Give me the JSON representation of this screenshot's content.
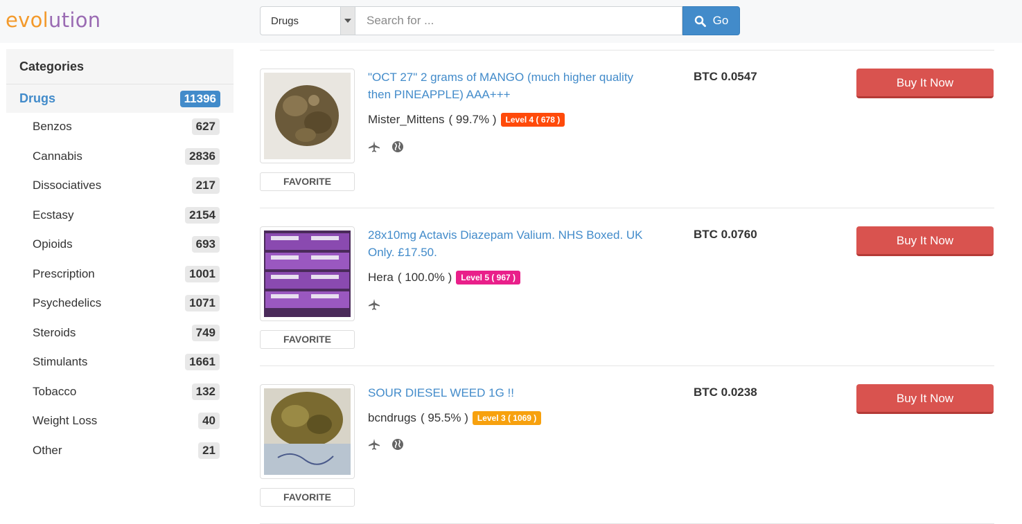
{
  "logo": {
    "part1": "evol",
    "part2": "ution"
  },
  "search": {
    "category_selected": "Drugs",
    "placeholder": "Search for ...",
    "value": "",
    "go_label": "Go"
  },
  "sidebar": {
    "heading": "Categories",
    "main": {
      "label": "Drugs",
      "count": "11396"
    },
    "items": [
      {
        "label": "Benzos",
        "count": "627"
      },
      {
        "label": "Cannabis",
        "count": "2836"
      },
      {
        "label": "Dissociatives",
        "count": "217"
      },
      {
        "label": "Ecstasy",
        "count": "2154"
      },
      {
        "label": "Opioids",
        "count": "693"
      },
      {
        "label": "Prescription",
        "count": "1001"
      },
      {
        "label": "Psychedelics",
        "count": "1071"
      },
      {
        "label": "Steroids",
        "count": "749"
      },
      {
        "label": "Stimulants",
        "count": "1661"
      },
      {
        "label": "Tobacco",
        "count": "132"
      },
      {
        "label": "Weight Loss",
        "count": "40"
      },
      {
        "label": "Other",
        "count": "21"
      }
    ]
  },
  "listings": [
    {
      "title": "\"OCT 27\" 2 grams of MANGO (much higher quality then PINEAPPLE) AAA+++",
      "vendor": "Mister_Mittens",
      "rating": "( 99.7% )",
      "level": "Level 4 ( 678 )",
      "level_color": "#ff4a0a",
      "price": "BTC 0.0547",
      "buy_label": "Buy It Now",
      "favorite_label": "FAVORITE",
      "icons": [
        "plane-icon",
        "globe-icon"
      ]
    },
    {
      "title": "28x10mg Actavis Diazepam Valium. NHS Boxed. UK Only. £17.50.",
      "vendor": "Hera",
      "rating": "( 100.0% )",
      "level": "Level 5 ( 967 )",
      "level_color": "#e91f8a",
      "price": "BTC 0.0760",
      "buy_label": "Buy It Now",
      "favorite_label": "FAVORITE",
      "icons": [
        "plane-icon"
      ]
    },
    {
      "title": "SOUR DIESEL WEED 1G !!",
      "vendor": "bcndrugs",
      "rating": "( 95.5% )",
      "level": "Level 3 ( 1069 )",
      "level_color": "#f7a10e",
      "price": "BTC 0.0238",
      "buy_label": "Buy It Now",
      "favorite_label": "FAVORITE",
      "icons": [
        "plane-icon",
        "globe-icon"
      ]
    }
  ]
}
